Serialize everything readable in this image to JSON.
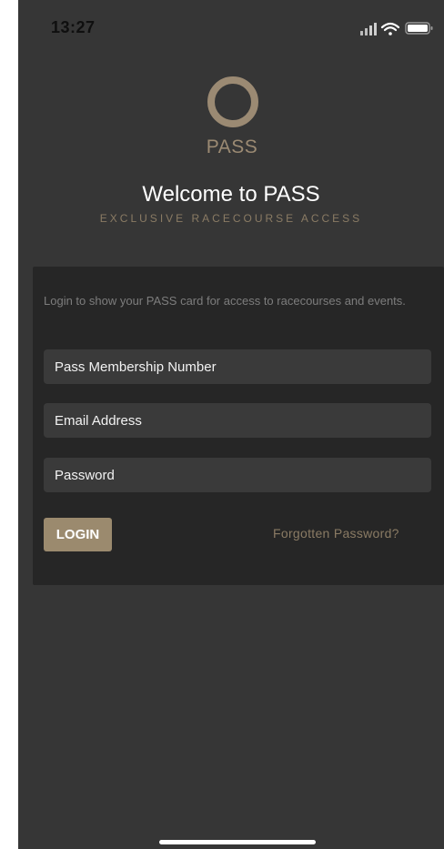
{
  "status_bar": {
    "time": "13:27",
    "icons": [
      "signal-icon",
      "wifi-icon",
      "battery-icon"
    ]
  },
  "brand": {
    "logo_text": "PASS",
    "title": "Welcome to PASS",
    "subtitle": "EXCLUSIVE RACECOURSE ACCESS"
  },
  "login": {
    "intro": "Login to show your PASS card for access to racecourses and events.",
    "fields": {
      "membership_placeholder": "Pass Membership Number",
      "email_placeholder": "Email Address",
      "password_placeholder": "Password"
    },
    "login_label": "LOGIN",
    "forgot_label": "Forgotten Password?"
  },
  "colors": {
    "background": "#363636",
    "card": "#262626",
    "field": "#3a3a3a",
    "accent": "#9b8a6e",
    "accent_text": "#8a7b64"
  }
}
